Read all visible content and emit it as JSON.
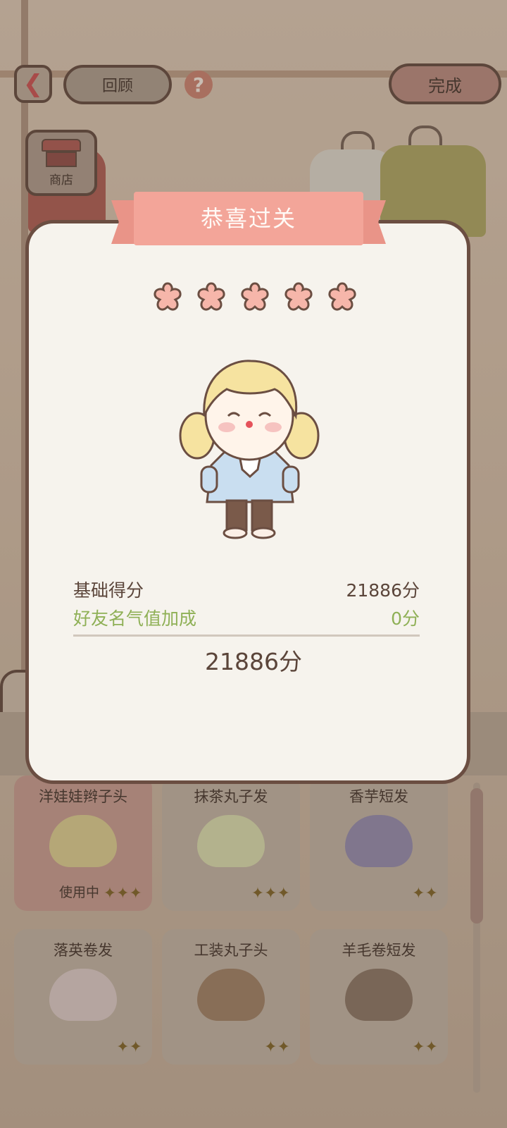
{
  "header": {
    "back_icon": "chevron-left-icon",
    "review_label": "回顾",
    "help_glyph": "?",
    "done_label": "完成",
    "shop_label": "商店"
  },
  "modal": {
    "title": "恭喜过关",
    "stars_filled": 5,
    "stars_total": 5,
    "base_score_label": "基础得分",
    "base_score_value": "21886分",
    "bonus_label": "好友名气值加成",
    "bonus_value": "0分",
    "total": "21886分"
  },
  "grid": {
    "items": [
      {
        "name": "洋娃娃辫子头",
        "status": "使用中",
        "hair_color": "#d8c98a",
        "active": true
      },
      {
        "name": "抹茶丸子发",
        "status": "",
        "hair_color": "#d6d8a8",
        "active": false
      },
      {
        "name": "香芋短发",
        "status": "",
        "hair_color": "#8f86a8",
        "active": false
      },
      {
        "name": "落英卷发",
        "status": "",
        "hair_color": "#d9c7c3",
        "active": false
      },
      {
        "name": "工装丸子头",
        "status": "",
        "hair_color": "#9a7a5e",
        "active": false
      },
      {
        "name": "羊毛卷短发",
        "status": "",
        "hair_color": "#86705e",
        "active": false
      }
    ]
  },
  "colors": {
    "banner": "#f3a599",
    "star_fill": "#f6b6aa",
    "modal_bg": "#f6f3ed",
    "bonus_text": "#8fb056"
  }
}
